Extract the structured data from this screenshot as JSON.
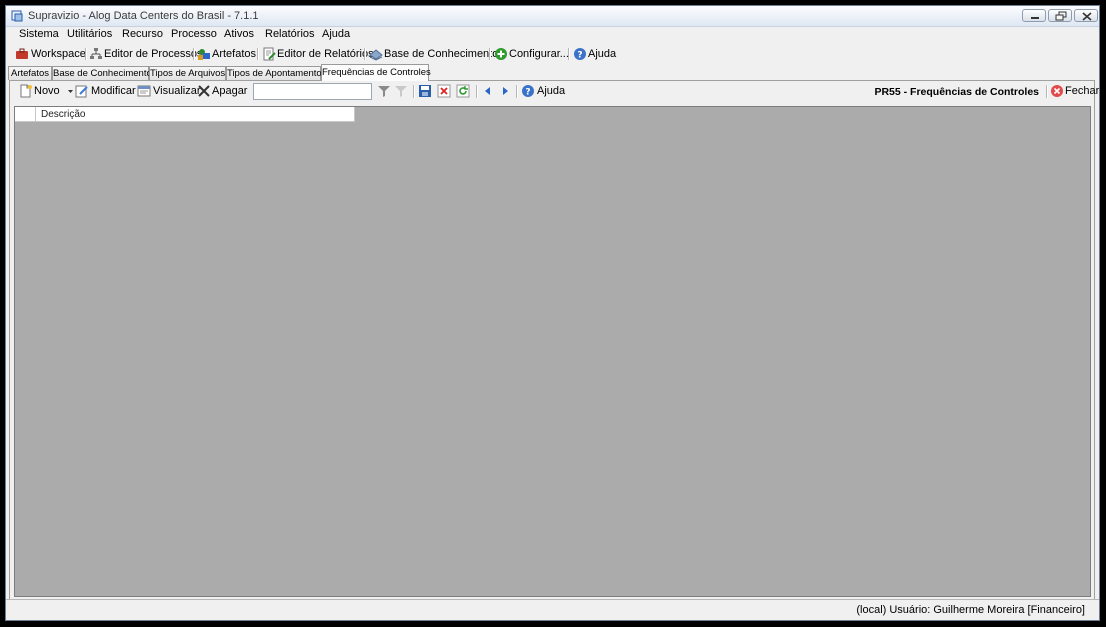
{
  "window": {
    "title": "Supravizio - Alog Data Centers do Brasil - 7.1.1",
    "controls": [
      "minimize-icon",
      "restore-icon",
      "close-icon"
    ]
  },
  "menu": [
    "Sistema",
    "Utilitários",
    "Recurso",
    "Processo",
    "Ativos",
    "Relatórios",
    "Ajuda"
  ],
  "toolbar": {
    "workspace": "Workspace",
    "editor_processos": "Editor de Processos",
    "artefatos": "Artefatos",
    "editor_relatorios": "Editor de Relatórios",
    "base_conhecimento": "Base de Conhecimento",
    "configurar": "Configurar...",
    "ajuda": "Ajuda"
  },
  "tabs": [
    {
      "label": "Artefatos",
      "active": false
    },
    {
      "label": "Base de Conhecimento",
      "active": false
    },
    {
      "label": "Tipos de Arquivos",
      "active": false
    },
    {
      "label": "Tipos de Apontamento",
      "active": false
    },
    {
      "label": "Frequências de Controles",
      "active": true
    }
  ],
  "actions": {
    "novo": "Novo",
    "modificar": "Modificar",
    "visualizar": "Visualizar",
    "apagar": "Apagar",
    "ajuda": "Ajuda",
    "fechar": "Fechar"
  },
  "search": {
    "value": "",
    "placeholder": ""
  },
  "screen_code": "PR55 - Frequências de Controles",
  "grid": {
    "columns": [
      "Descrição"
    ],
    "rows": []
  },
  "status": {
    "text": "(local)  Usuário: Guilherme Moreira [Financeiro]"
  },
  "colors": {
    "grid_bg": "#ababab",
    "titlebar": "#dfe8f3",
    "accent_blue": "#2a66c8"
  }
}
